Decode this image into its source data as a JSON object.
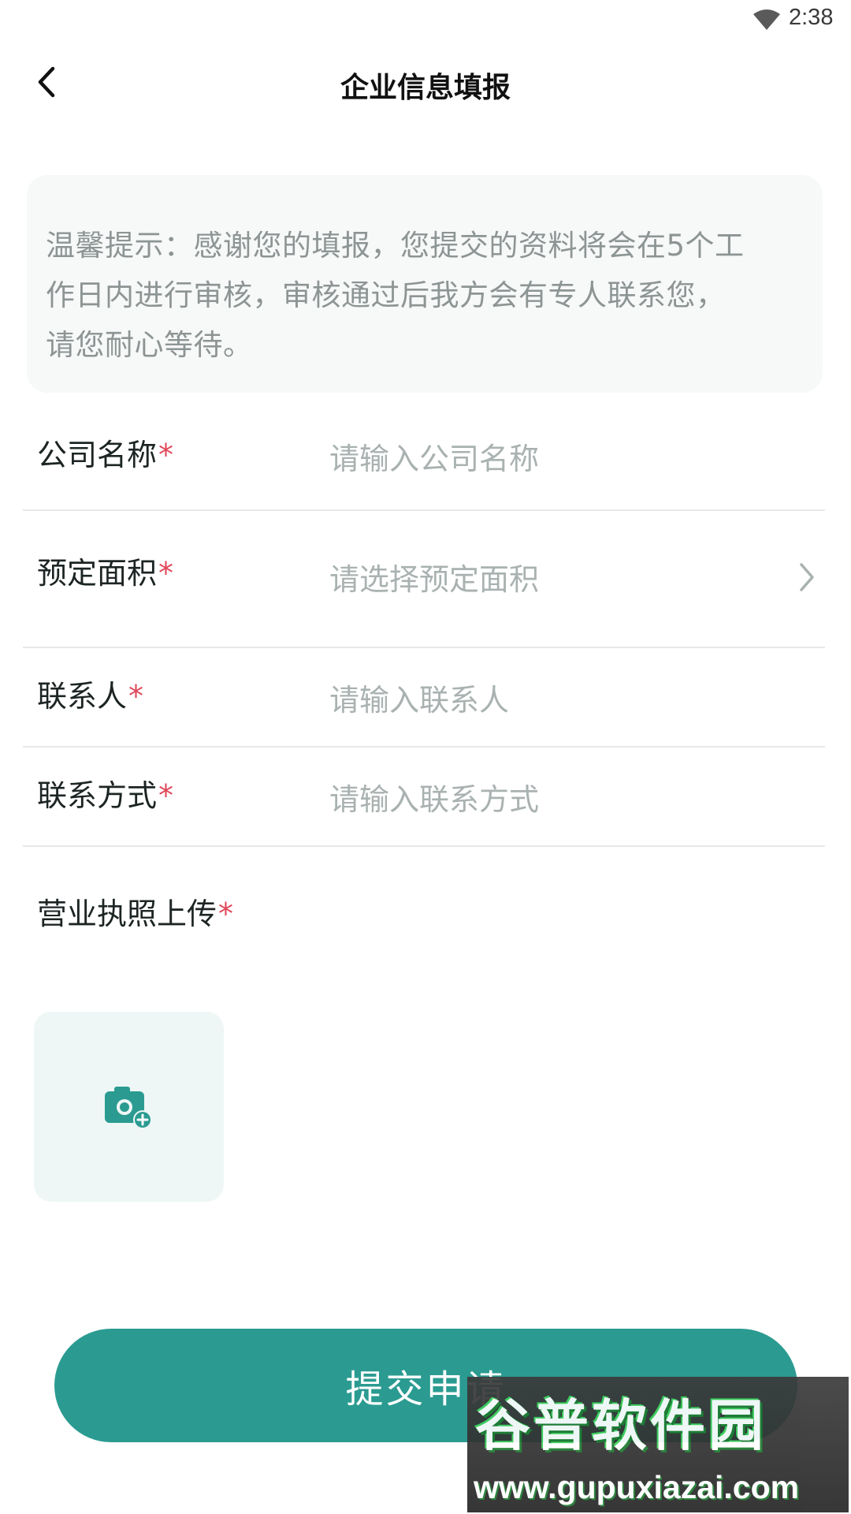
{
  "status_bar": {
    "time": "2:38",
    "wifi_icon": "wifi-icon"
  },
  "header": {
    "back_icon": "chevron-left-icon",
    "title": "企业信息填报"
  },
  "notice": {
    "lines": [
      "温馨提示：感谢您的填报，您提交的资料将会在5个工",
      "作日内进行审核，审核通过后我方会有专人联系您，",
      "请您耐心等待。"
    ]
  },
  "form": {
    "required_mark": "*",
    "company_name": {
      "label": "公司名称",
      "placeholder": "请输入公司名称",
      "value": ""
    },
    "reserved_area": {
      "label": "预定面积",
      "placeholder": "请选择预定面积",
      "icon": "chevron-right-icon"
    },
    "contact_person": {
      "label": "联系人",
      "placeholder": "请输入联系人",
      "value": ""
    },
    "contact_method": {
      "label": "联系方式",
      "placeholder": "请输入联系方式",
      "value": ""
    },
    "license_upload": {
      "label": "营业执照上传",
      "icon": "camera-add-icon"
    }
  },
  "submit": {
    "label": "提交申请"
  },
  "watermark": {
    "title": "谷普软件园",
    "url": "www.gupuxiazai.com"
  },
  "colors": {
    "accent": "#2b9b91",
    "required": "#e0485a",
    "placeholder": "#a9b2b1",
    "notice_bg": "#f7f8f8",
    "upload_bg": "#eef7f6"
  }
}
